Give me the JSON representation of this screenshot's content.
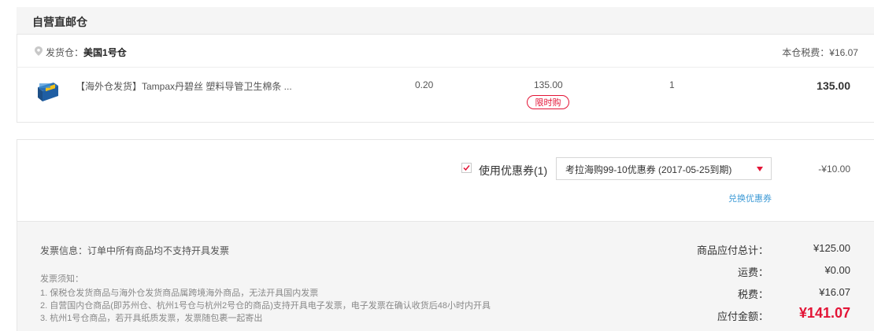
{
  "section": {
    "title": "自营直邮仓",
    "warehouse_label": "发货仓：",
    "warehouse_name": "美国1号仓",
    "tax_label": "本仓税费：¥16.07"
  },
  "item": {
    "name": "【海外仓发货】Tampax丹碧丝 塑料导管卫生棉条 ...",
    "weight": "0.20",
    "price": "135.00",
    "badge": "限时购",
    "quantity": "1",
    "subtotal": "135.00"
  },
  "coupon": {
    "label": "使用优惠券(1)",
    "selected": "考拉海购99-10优惠券 (2017-05-25到期)",
    "discount": "-¥10.00",
    "redeem_link": "兑换优惠券"
  },
  "invoice": {
    "info": "发票信息：订单中所有商品均不支持开具发票",
    "notes_title": "发票须知：",
    "notes": [
      "1. 保税仓发货商品与海外仓发货商品属跨境海外商品，无法开具国内发票",
      "2. 自营国内仓商品(即苏州仓、杭州1号仓与杭州2号仓的商品)支持开具电子发票，电子发票在确认收货后48小时内开具",
      "3. 杭州1号仓商品，若开具纸质发票，发票随包裹一起寄出"
    ]
  },
  "summary": {
    "goods_label": "商品应付总计：",
    "goods_value": "¥125.00",
    "shipping_label": "运费：",
    "shipping_value": "¥0.00",
    "tax_label": "税费：",
    "tax_value": "¥16.07",
    "total_label": "应付金额：",
    "total_value": "¥141.07"
  },
  "colors": {
    "accent": "#e31436",
    "link": "#3d9ad6",
    "panel": "#f5f5f5"
  }
}
